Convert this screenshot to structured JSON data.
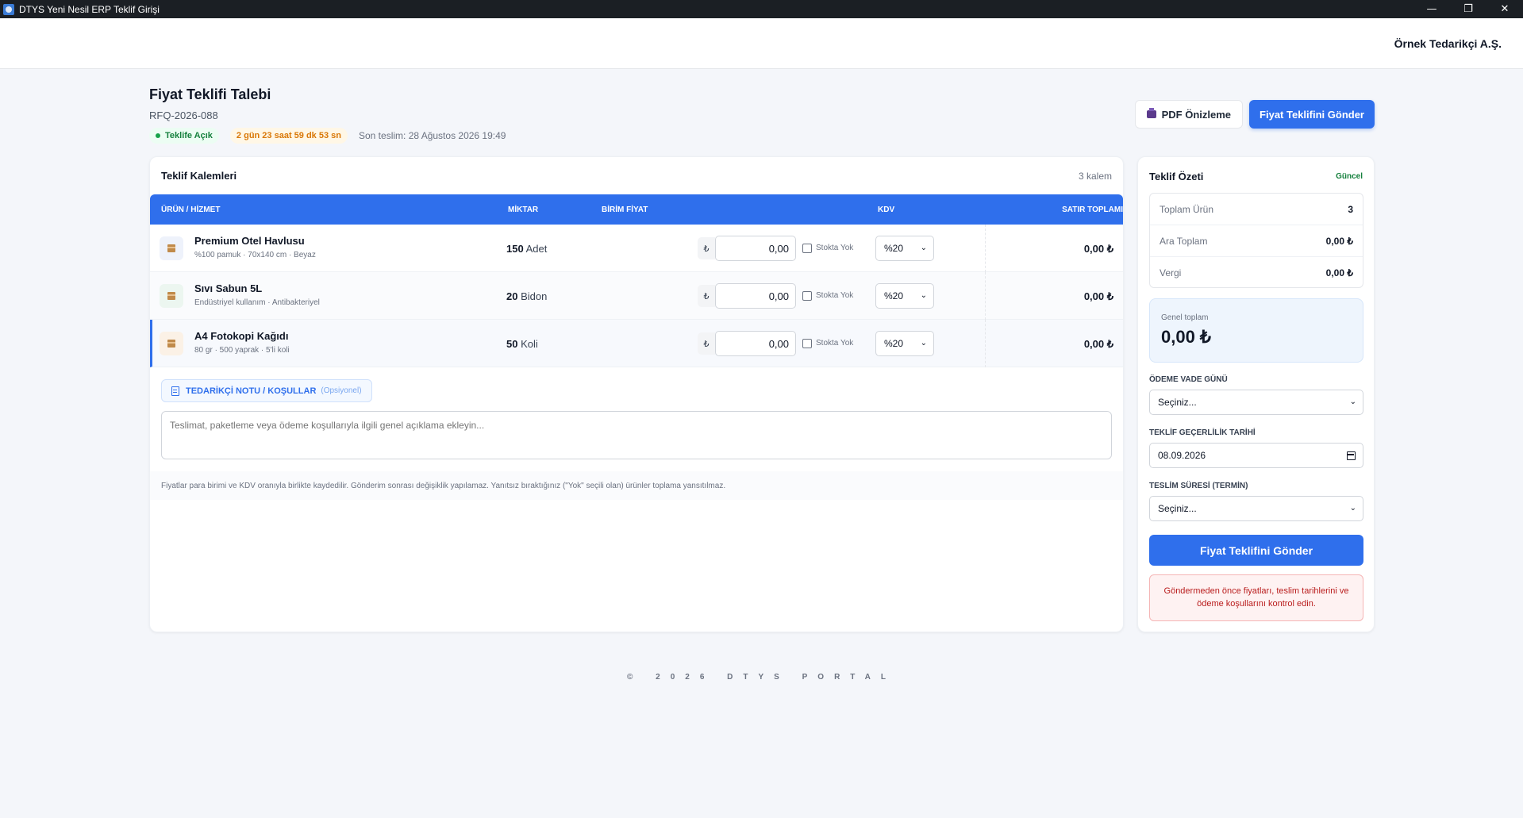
{
  "window": {
    "title": "DTYS Yeni Nesil ERP Teklif Girişi",
    "minimize": "—",
    "maximize": "❐",
    "close": "✕"
  },
  "header": {
    "supplier": "Örnek Tedarikçi A.Ş."
  },
  "page": {
    "title": "Fiyat Teklifi Talebi",
    "code": "RFQ-2026-088",
    "status": "Teklife Açık",
    "countdown": "2 gün 23 saat 59 dk 53 sn",
    "deadline": "Son teslim: 28 Ağustos 2026 19:49",
    "pdf_label": "PDF Önizleme",
    "send_label": "Fiyat Teklifini Gönder"
  },
  "items_card": {
    "title": "Teklif Kalemleri",
    "count": "3 kalem",
    "columns": {
      "product": "ÜRÜN / HİZMET",
      "qty": "MİKTAR",
      "unit_price": "BİRİM FİYAT",
      "kdv": "KDV",
      "line_total": "SATIR TOPLAMI"
    },
    "currency_symbol": "₺",
    "stock_label": "Stokta Yok",
    "rows": [
      {
        "name": "Premium Otel Havlusu",
        "desc": "%100 pamuk · 70x140 cm · Beyaz",
        "qty": "150",
        "unit": "Adet",
        "price": "0,00",
        "kdv": "%20",
        "total": "0,00 ₺"
      },
      {
        "name": "Sıvı Sabun 5L",
        "desc": "Endüstriyel kullanım · Antibakteriyel",
        "qty": "20",
        "unit": "Bidon",
        "price": "0,00",
        "kdv": "%20",
        "total": "0,00 ₺"
      },
      {
        "name": "A4 Fotokopi Kağıdı",
        "desc": "80 gr · 500 yaprak · 5'li koli",
        "qty": "50",
        "unit": "Koli",
        "price": "0,00",
        "kdv": "%20",
        "total": "0,00 ₺"
      }
    ],
    "note_label": "TEDARİKÇİ NOTU / KOŞULLAR",
    "note_optional": "(Opsiyonel)",
    "note_placeholder": "Teslimat, paketleme veya ödeme koşullarıyla ilgili genel açıklama ekleyin...",
    "footnote": "Fiyatlar para birimi ve KDV oranıyla birlikte kaydedilir. Gönderim sonrası değişiklik yapılamaz. Yanıtsız bıraktığınız (\"Yok\" seçili olan) ürünler toplama yansıtılmaz."
  },
  "summary": {
    "title": "Teklif Özeti",
    "status": "Güncel",
    "total_items_label": "Toplam Ürün",
    "total_items": "3",
    "subtotal_label": "Ara Toplam",
    "subtotal": "0,00 ₺",
    "tax_label": "Vergi",
    "tax": "0,00 ₺",
    "grand_label": "Genel toplam",
    "grand": "0,00 ₺",
    "payment_label": "ÖDEME VADE GÜNÜ",
    "payment_value": "Seçiniz...",
    "validity_label": "TEKLİF GEÇERLİLİK TARİHİ",
    "validity_value": "08.09.2026",
    "delivery_label": "TESLİM SÜRESİ (TERMİN)",
    "delivery_value": "Seçiniz...",
    "send_label": "Fiyat Teklifini Gönder",
    "warning": "Göndermeden önce fiyatları, teslim tarihlerini ve ödeme koşullarını kontrol edin."
  },
  "footer": "© 2026 DTYS PORTAL",
  "colors": {
    "primary": "#2f6fec",
    "success": "#15803d",
    "warning": "#d97706",
    "danger": "#b91c1c"
  }
}
